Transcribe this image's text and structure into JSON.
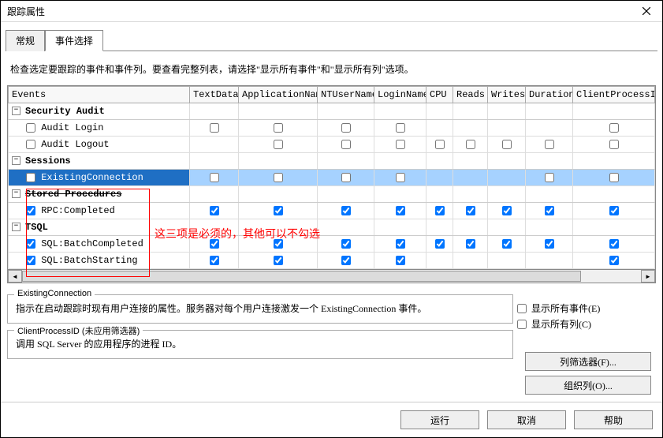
{
  "window": {
    "title": "跟踪属性"
  },
  "tabs": {
    "general": "常规",
    "events": "事件选择"
  },
  "instructions": "检查选定要跟踪的事件和事件列。要查看完整列表，请选择\"显示所有事件\"和\"显示所有列\"选项。",
  "columns": {
    "events": "Events",
    "textdata": "TextData",
    "appname": "ApplicationName",
    "ntuser": "NTUserName",
    "login": "LoginName",
    "cpu": "CPU",
    "reads": "Reads",
    "writes": "Writes",
    "duration": "Duration",
    "clientprocess": "ClientProcessID"
  },
  "categories": {
    "security": "Security Audit",
    "sessions": "Sessions",
    "stored": "Stored Procedures",
    "tsql": "TSQL"
  },
  "events_list": {
    "audit_login": "Audit Login",
    "audit_logout": "Audit Logout",
    "existing_conn": "ExistingConnection",
    "rpc_completed": "RPC:Completed",
    "batch_completed": "SQL:BatchCompleted",
    "batch_starting": "SQL:BatchStarting"
  },
  "annotation": "这三项是必须的，其他可以不勾选",
  "desc1": {
    "title": "ExistingConnection",
    "body": "指示在启动跟踪时现有用户连接的属性。服务器对每个用户连接激发一个 ExistingConnection 事件。"
  },
  "desc2": {
    "title": "ClientProcessID (未应用筛选器)",
    "body": "调用 SQL Server 的应用程序的进程 ID。"
  },
  "options": {
    "show_all_events": "显示所有事件(E)",
    "show_all_cols": "显示所有列(C)"
  },
  "buttons": {
    "filter": "列筛选器(F)...",
    "organize": "组织列(O)...",
    "run": "运行",
    "cancel": "取消",
    "help": "帮助"
  }
}
